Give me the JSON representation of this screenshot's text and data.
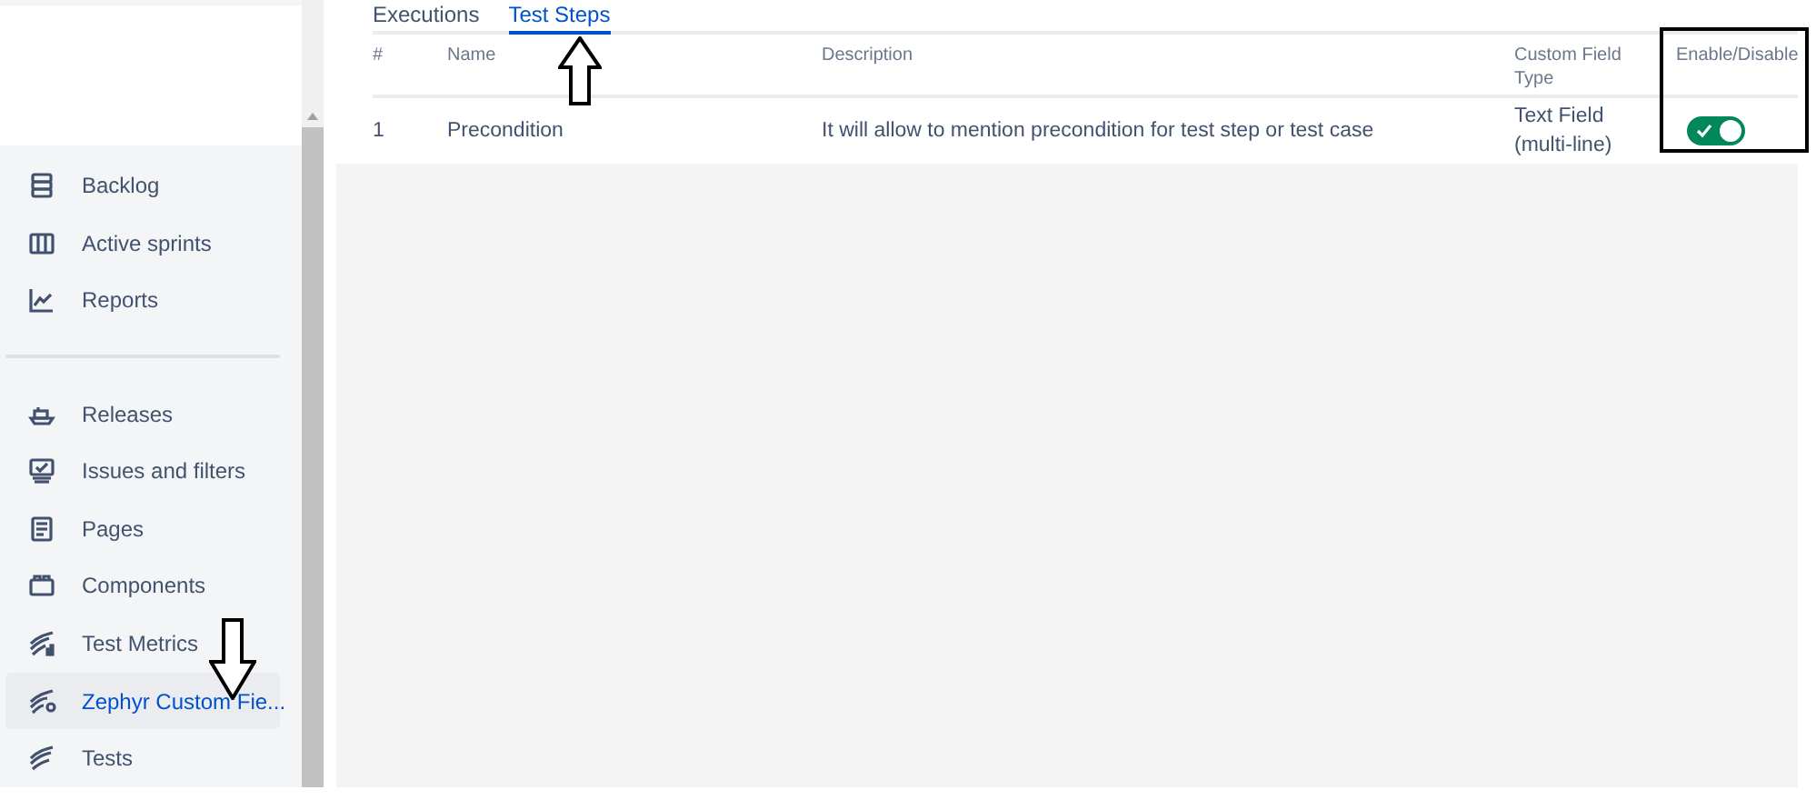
{
  "sidebar": {
    "groups": [
      {
        "items": [
          {
            "label": "Backlog",
            "selected": false
          },
          {
            "label": "Active sprints",
            "selected": false
          },
          {
            "label": "Reports",
            "selected": false
          }
        ]
      },
      {
        "items": [
          {
            "label": "Releases",
            "selected": false
          },
          {
            "label": "Issues and filters",
            "selected": false
          },
          {
            "label": "Pages",
            "selected": false
          },
          {
            "label": "Components",
            "selected": false
          },
          {
            "label": "Test Metrics",
            "selected": false
          },
          {
            "label": "Zephyr Custom Fie...",
            "selected": true
          },
          {
            "label": "Tests",
            "selected": false
          }
        ]
      }
    ]
  },
  "tabs": [
    {
      "label": "Executions",
      "selected": false
    },
    {
      "label": "Test Steps",
      "selected": true
    }
  ],
  "table": {
    "columns": [
      "#",
      "Name",
      "Description",
      "Custom Field Type",
      "Enable/Disable"
    ],
    "rows": [
      {
        "number": "1",
        "name": "Precondition",
        "description": "It will allow to mention precondition for test step or test case",
        "type": "Text Field (multi-line)",
        "enabled": true
      }
    ]
  },
  "annotations": [
    {
      "kind": "up-arrow"
    },
    {
      "kind": "down-arrow"
    },
    {
      "kind": "box"
    }
  ]
}
